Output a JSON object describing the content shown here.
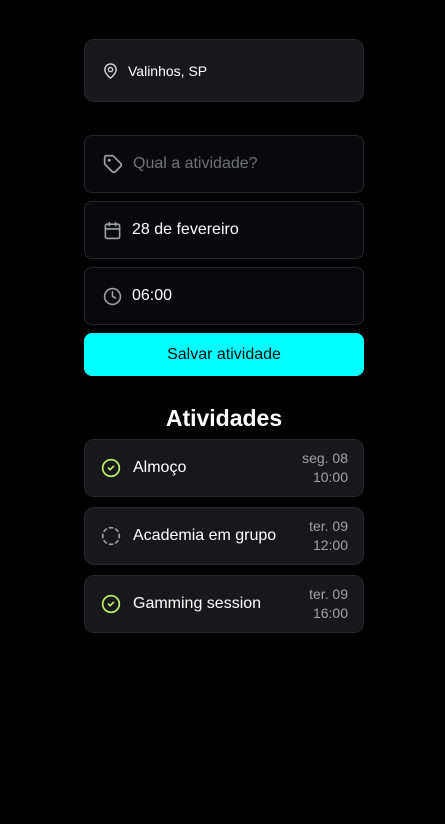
{
  "location": {
    "icon": "map-pin-icon",
    "city": "Valinhos, SP"
  },
  "form": {
    "activity_placeholder": "Qual a atividade?",
    "activity_value": "",
    "date": "28 de fevereiro",
    "time": "06:00",
    "save_label": "Salvar atividade"
  },
  "activities": {
    "title": "Atividades",
    "items": [
      {
        "name": "Almoço",
        "day": "seg. 08",
        "time": "10:00",
        "done": true
      },
      {
        "name": "Academia em grupo",
        "day": "ter. 09",
        "time": "12:00",
        "done": false
      },
      {
        "name": "Gamming session",
        "day": "ter. 09",
        "time": "16:00",
        "done": true
      }
    ]
  },
  "colors": {
    "background": "#000000",
    "card": "#18181b",
    "input": "#09090b",
    "border": "#27272a",
    "accent": "#00ffff",
    "done": "#bef264",
    "muted": "#a1a1aa"
  }
}
